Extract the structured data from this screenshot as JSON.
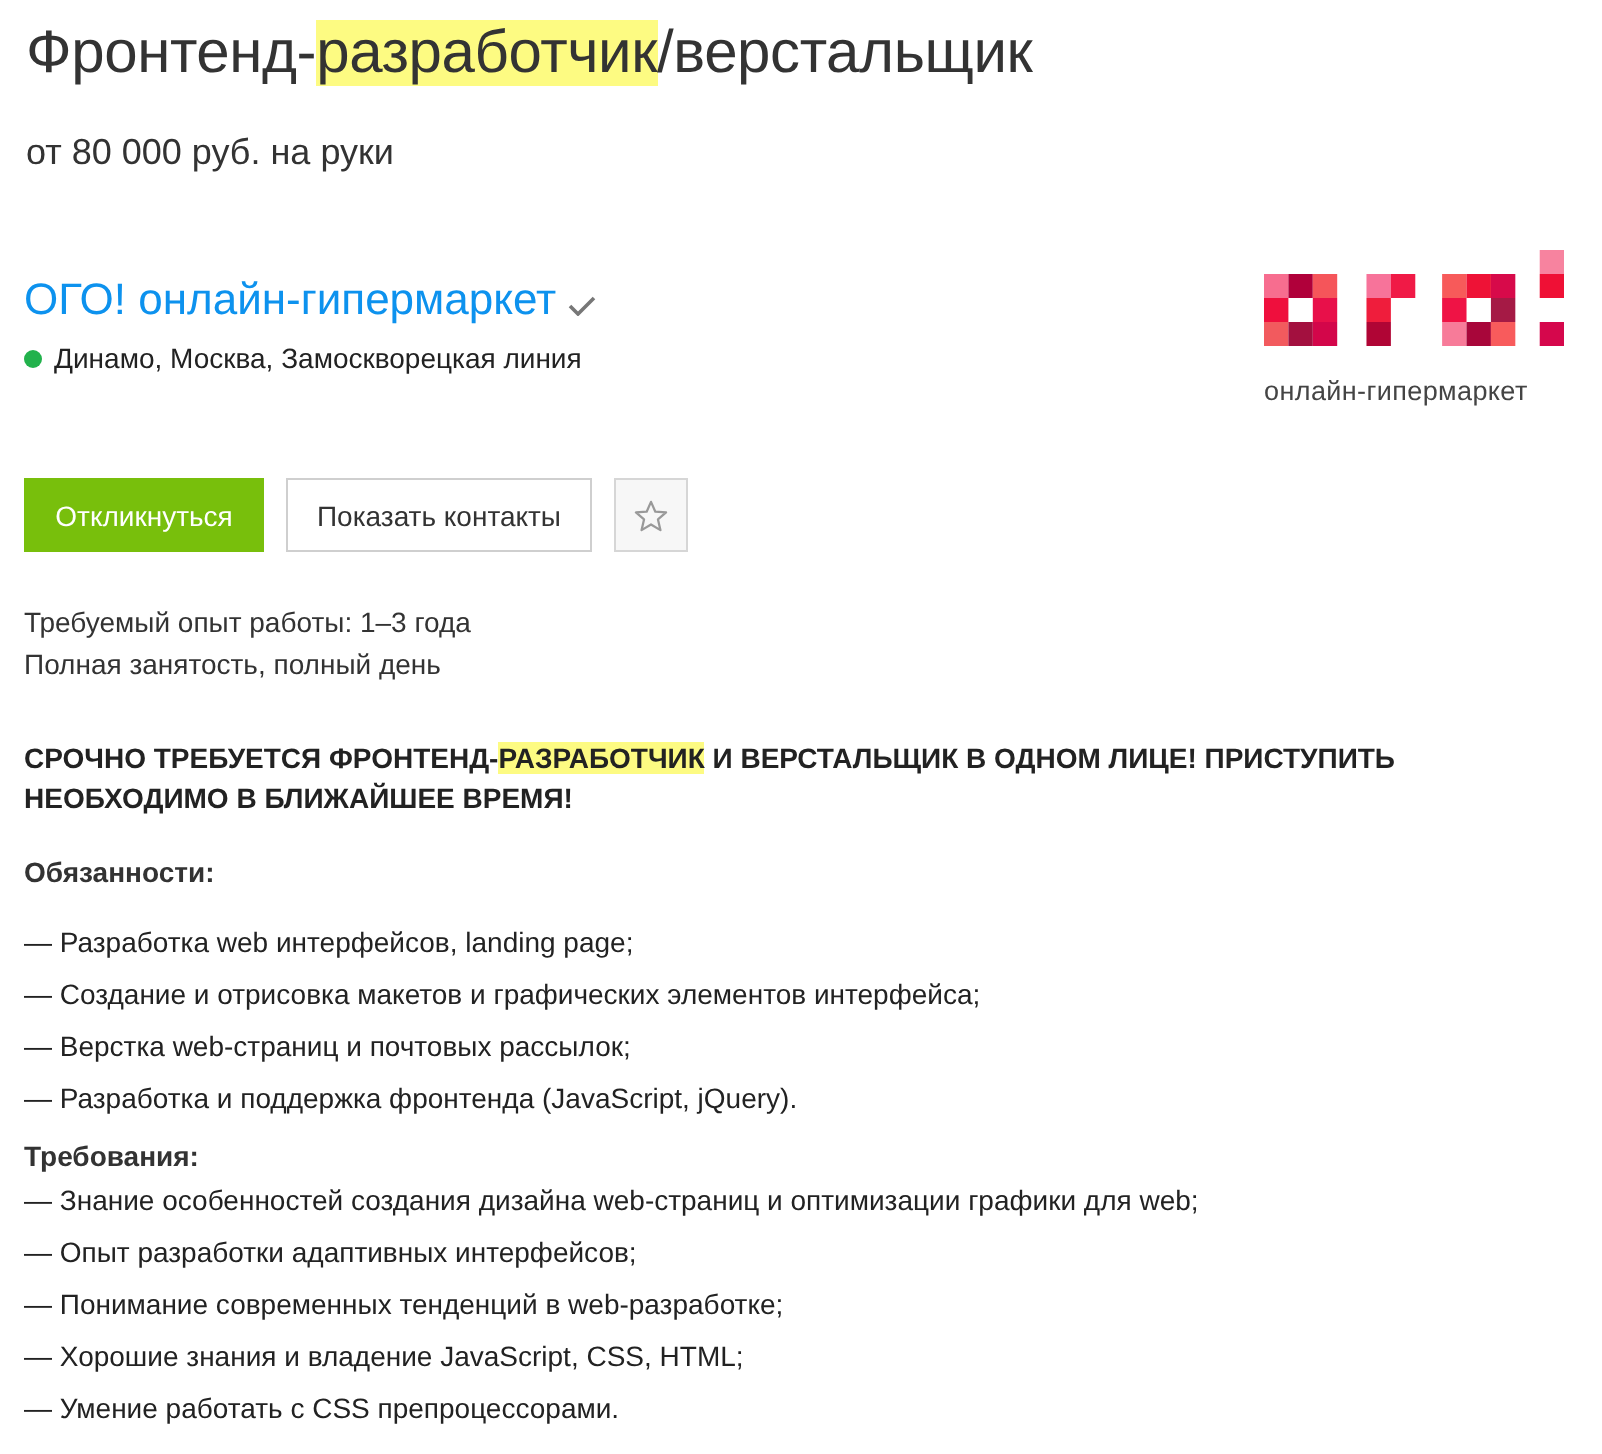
{
  "vacancy": {
    "title": [
      {
        "text": "Фронтенд-",
        "highlighted": false
      },
      {
        "text": "разработчик",
        "highlighted": true
      },
      {
        "text": "/верстальщик",
        "highlighted": false
      }
    ],
    "salary": "от 80 000 руб. на руки"
  },
  "employer": {
    "name": "ОГО! онлайн-гипермаркет",
    "verified": true,
    "location": {
      "text": "Динамо, Москва, Замоскворецкая линия",
      "color": "#22b24c"
    },
    "logo": {
      "caption": "онлайн-гипермаркет"
    }
  },
  "actions": [
    {
      "kind": "primary",
      "label": "Откликнуться"
    },
    {
      "kind": "secondary",
      "label": "Показать контакты"
    },
    {
      "kind": "favorite",
      "on": false
    }
  ],
  "details": [
    "Требуемый опыт работы: 1–3 года",
    "Полная занятость, полный день"
  ],
  "description": {
    "lead": [
      {
        "text": "СРОЧНО ТРЕБУЕТСЯ ФРОНТЕНД-",
        "highlighted": false
      },
      {
        "text": "РАЗРАБОТЧИК",
        "highlighted": true
      },
      {
        "text": " И ВЕРСТАЛЬЩИК В ОДНОМ ЛИЦЕ! ПРИСТУПИТЬ НЕОБХОДИМО В БЛИЖАЙШЕЕ ВРЕМЯ!",
        "highlighted": false
      }
    ],
    "sections": [
      {
        "heading": "Обязанности:",
        "items": [
          "— Разработка web интерфейсов, landing page;",
          "— Создание и отрисовка макетов и графических элементов интерфейса;",
          "— Верстка web-страниц и почтовых рассылок;",
          "— Разработка и поддержка фронтенда (JavaScript, jQuery)."
        ]
      },
      {
        "heading": "Требования:",
        "items": [
          "— Знание особенностей создания дизайна web-страниц и оптимизации графики для web;",
          "— Опыт разработки адаптивных интерфейсов;",
          "— Понимание современных тенденций в web-разработке;",
          "— Хорошие знания и владение JavaScript, CSS, HTML;",
          "— Умение работать с CSS препроцессорами."
        ]
      }
    ]
  }
}
